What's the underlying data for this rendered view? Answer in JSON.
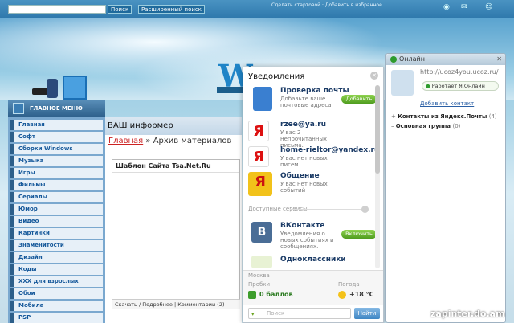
{
  "topbar": {
    "search_button": "Поиск",
    "advanced_search": "Расширенный поиск",
    "links": "Сделать стартовой · Добавить в избранное"
  },
  "menu": {
    "header": "ГЛАВНОЕ МЕНЮ",
    "items": [
      "Главная",
      "Софт",
      "Сборки Windows",
      "Музыка",
      "Игры",
      "Фильмы",
      "Сериалы",
      "Юмор",
      "Видео",
      "Картинки",
      "Знаменитости",
      "Дизайн",
      "Коды",
      "XXX для взрослых",
      "Обои",
      "Мобила",
      "PSP"
    ]
  },
  "content": {
    "informer": "ВАШ информер",
    "crumb_home": "Главная",
    "crumb_sep": " » ",
    "crumb_current": "Архив материалов",
    "template_title": "Шаблон Сайта Tsa.Net.Ru",
    "footer": "Скачать / Подробнее  |  Комментарии (2)"
  },
  "notifications": {
    "title": "Уведомления",
    "items": [
      {
        "title": "Проверка почты",
        "desc": "Добавьте ваше почтовые адреса.",
        "button": "Добавить"
      },
      {
        "title": "rzee@ya.ru",
        "desc": "У вас 2 непрочитанных письма."
      },
      {
        "title": "home-rieltor@yandex.ru",
        "desc": "У вас нет новых писем."
      },
      {
        "title": "Общение",
        "desc": "У вас нет новых событий"
      }
    ],
    "available_title": "Доступные сервисы",
    "services": [
      {
        "title": "ВКонтакте",
        "desc": "Уведомления о новых событиях и сообщениях.",
        "button": "Включить"
      },
      {
        "title": "Одноклассники",
        "desc": ""
      }
    ],
    "location": "Москва",
    "traffic_label": "Пробки",
    "traffic_value": "0 баллов",
    "weather_label": "Погода",
    "weather_value": "+18 °С",
    "search_placeholder": "Поиск",
    "search_button": "Найти"
  },
  "online": {
    "title": "Онлайн",
    "url": "http://ucoz4you.ucoz.ru/",
    "status": "Работает Я.Онлайн",
    "add_contact": "Добавить контакт",
    "groups": [
      {
        "name": "Контакты из Яндекс.Почты",
        "count": "(4)"
      },
      {
        "name": "Основная группа",
        "count": "(0)"
      }
    ]
  },
  "watermark": "zapinter.do.am"
}
